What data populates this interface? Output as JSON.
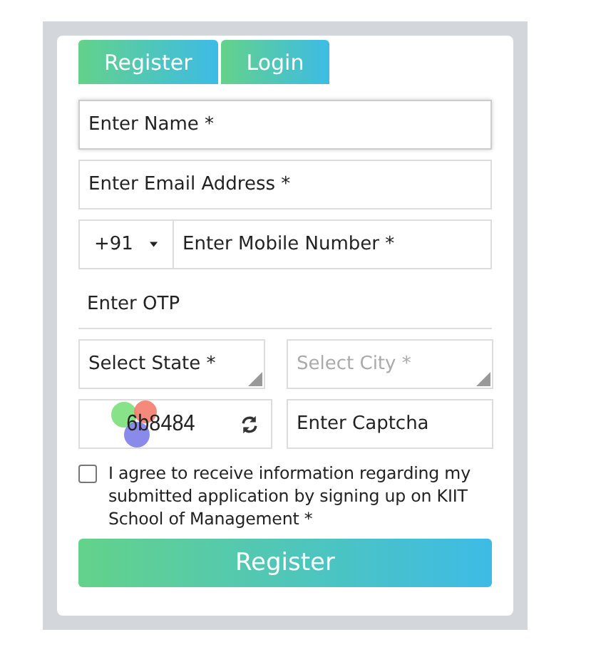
{
  "tabs": [
    {
      "label": "Register"
    },
    {
      "label": "Login"
    }
  ],
  "fields": [
    {
      "kind": "text",
      "placeholder": "Enter Name *",
      "focused": true
    },
    {
      "kind": "text",
      "placeholder": "Enter Email Address *",
      "focused": false
    },
    {
      "kind": "phone",
      "code": "+91",
      "placeholder": "Enter Mobile Number *",
      "focused": false
    },
    {
      "kind": "underline",
      "placeholder": "Enter OTP",
      "focused": false
    }
  ],
  "selects": [
    {
      "placeholder": "Select State *",
      "disabled": false
    },
    {
      "placeholder": "Select City *",
      "disabled": true
    }
  ],
  "captcha": {
    "code": "6b8484",
    "placeholder": "Enter Captcha"
  },
  "consent": {
    "checked": false,
    "text": "I agree to receive information regarding my submitted application by signing up on KIIT School of Management *"
  },
  "submit": "Register"
}
